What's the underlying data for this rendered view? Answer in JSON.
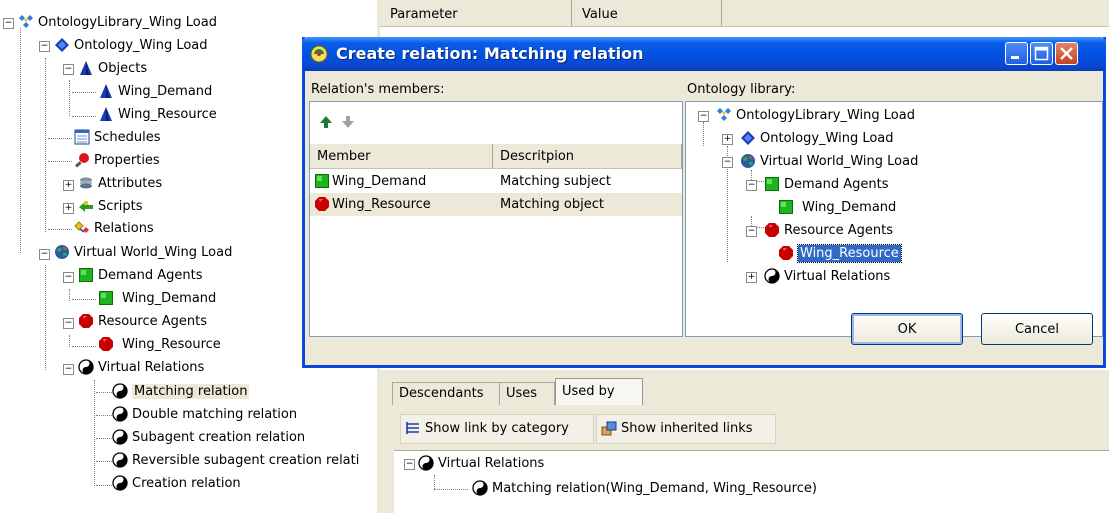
{
  "tree": {
    "library": "OntologyLibrary_Wing Load",
    "ontology": "Ontology_Wing Load",
    "objects": "Objects",
    "obj_demand": "Wing_Demand",
    "obj_resource": "Wing_Resource",
    "schedules": "Schedules",
    "properties": "Properties",
    "attributes": "Attributes",
    "scripts": "Scripts",
    "relations": "Relations",
    "virtual_world": "Virtual World_Wing Load",
    "demand_agents": "Demand Agents",
    "vw_demand": "Wing_Demand",
    "resource_agents": "Resource Agents",
    "vw_resource": "Wing_Resource",
    "virtual_relations": "Virtual Relations",
    "rel_matching": "Matching relation",
    "rel_double": "Double matching relation",
    "rel_subagent": "Subagent creation relation",
    "rel_reversible": "Reversible subagent creation relati",
    "rel_creation": "Creation relation"
  },
  "property_header": {
    "col1": "Parameter",
    "col2": "Value"
  },
  "dialog": {
    "title": "Create relation: Matching relation",
    "members_label": "Relation's members:",
    "library_label": "Ontology library:",
    "columns": [
      "Member",
      "Descritpion"
    ],
    "members": [
      {
        "name": "Wing_Demand",
        "description": "Matching subject"
      },
      {
        "name": "Wing_Resource",
        "description": "Matching object"
      }
    ],
    "library_tree": {
      "library": "OntologyLibrary_Wing Load",
      "ontology": "Ontology_Wing Load",
      "virtual_world": "Virtual World_Wing Load",
      "demand_agents": "Demand Agents",
      "demand": "Wing_Demand",
      "resource_agents": "Resource Agents",
      "resource": "Wing_Resource",
      "virtual_relations": "Virtual Relations"
    },
    "ok_label": "OK",
    "cancel_label": "Cancel"
  },
  "lower": {
    "tabs": [
      "Descendants",
      "Uses",
      "Used by"
    ],
    "active_tab": "Used by",
    "show_by_category": "Show link by category",
    "show_inherited": "Show inherited links",
    "used_root": "Virtual Relations",
    "used_item": "Matching relation(Wing_Demand, Wing_Resource)"
  },
  "colors": {
    "titlebar": "#0054e3",
    "selection": "#316ac5",
    "window_bg": "#ece9d8",
    "demand_green": "#1eb41e",
    "resource_red": "#c80000"
  }
}
